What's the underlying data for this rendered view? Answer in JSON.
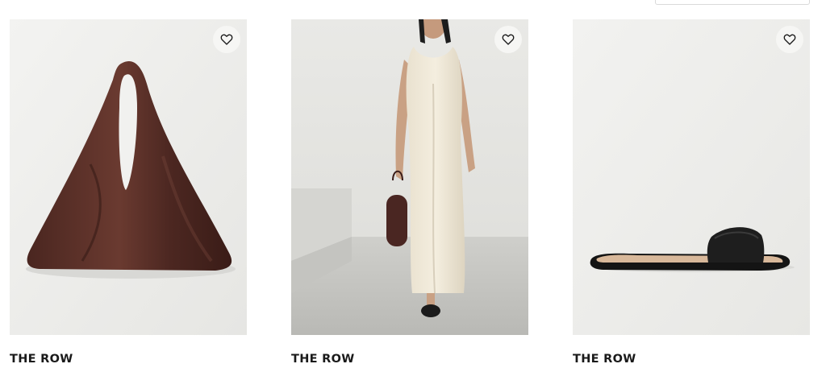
{
  "products": [
    {
      "brand": "THE ROW",
      "image_icon": "leather-hobo-bag-image",
      "wishlist_icon": "heart-outline-icon"
    },
    {
      "brand": "THE ROW",
      "image_icon": "cream-maxi-dress-model-image",
      "wishlist_icon": "heart-outline-icon"
    },
    {
      "brand": "THE ROW",
      "image_icon": "black-slide-sandal-image",
      "wishlist_icon": "heart-outline-icon"
    }
  ],
  "colors": {
    "background": "#ffffff",
    "brand_text": "#1a1a1a",
    "image_bg": "#efefed"
  }
}
